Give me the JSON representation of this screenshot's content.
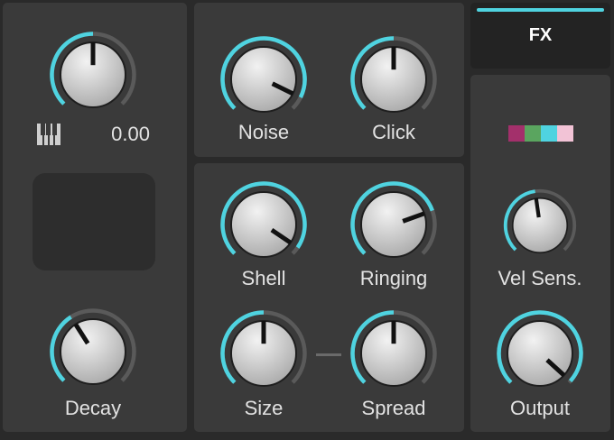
{
  "colors": {
    "accent": "#4fd3e0",
    "track": "#5a5a5a",
    "panel": "#3a3a3a"
  },
  "left": {
    "pitch_value": "0.00",
    "keyboard_icon": "piano-keys-icon",
    "decay_label": "Decay"
  },
  "noise_click": {
    "noise_label": "Noise",
    "click_label": "Click"
  },
  "body": {
    "shell_label": "Shell",
    "ringing_label": "Ringing",
    "size_label": "Size",
    "spread_label": "Spread"
  },
  "right": {
    "fx_label": "FX",
    "swatch_colors": [
      "#a3306b",
      "#5aa55f",
      "#4fd3e0",
      "#f2c3d6"
    ],
    "vel_sens_label": "Vel Sens.",
    "output_label": "Output"
  },
  "knobs": {
    "pitch": 0.5,
    "decay": 0.38,
    "noise": 0.93,
    "click": 0.5,
    "shell": 0.96,
    "ringing": 0.76,
    "size": 0.5,
    "spread": 0.5,
    "vel_sens": 0.47,
    "output": 0.99
  }
}
